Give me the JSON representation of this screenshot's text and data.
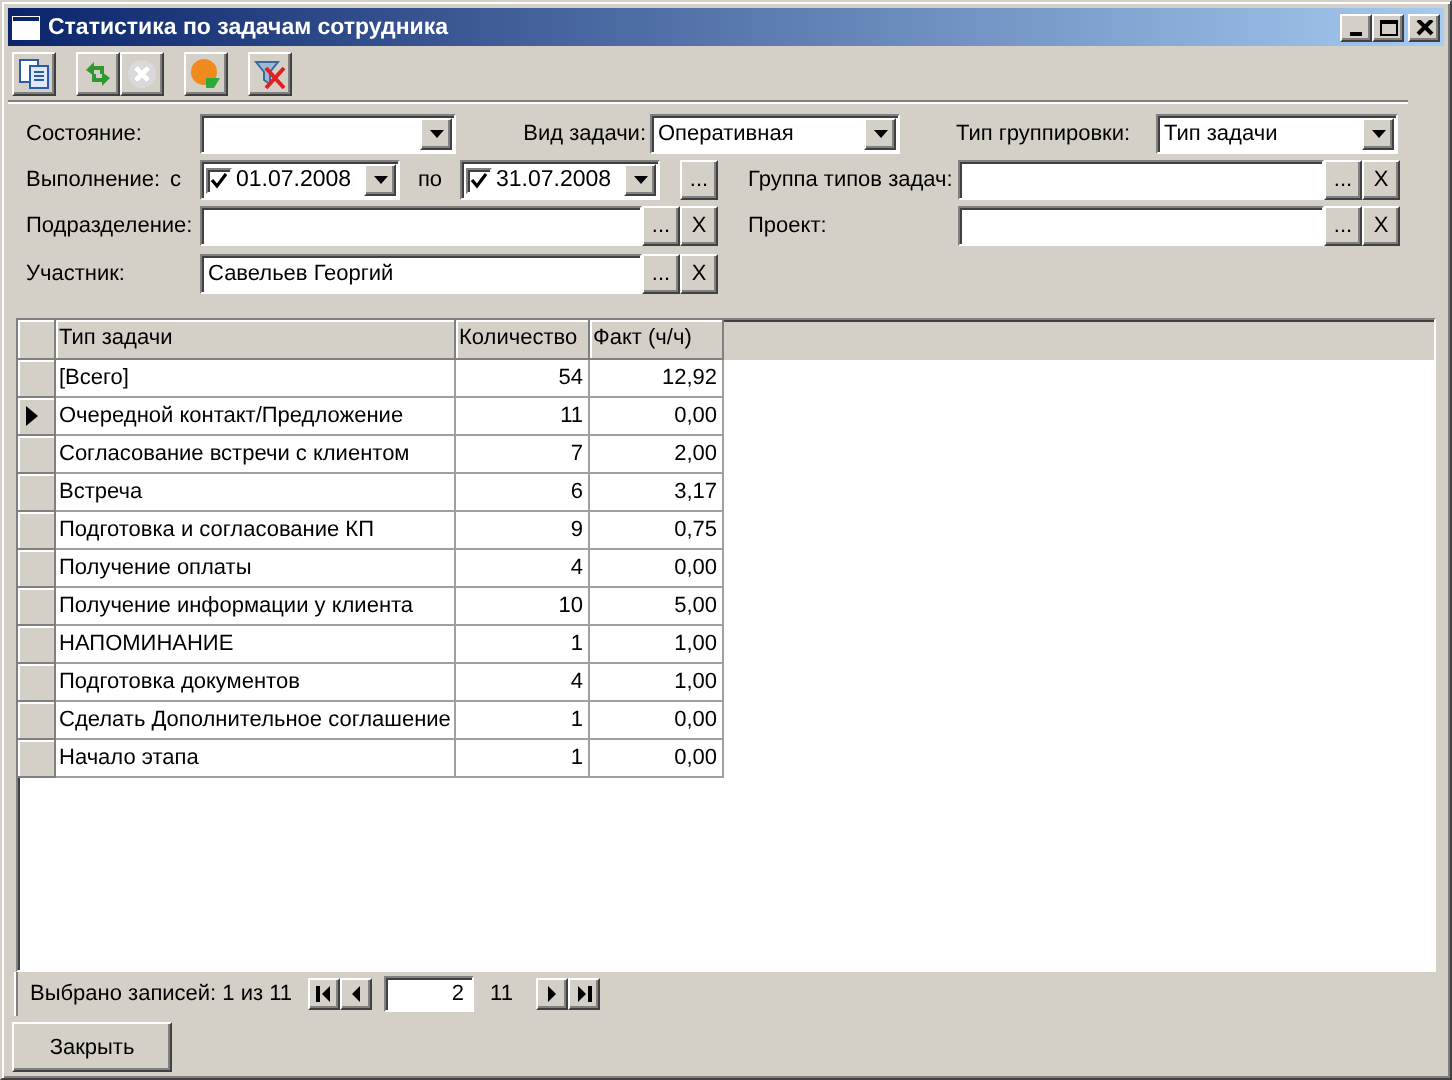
{
  "window": {
    "title": "Статистика по задачам сотрудника"
  },
  "toolbar": [
    [
      {
        "kind": "copy",
        "disabled": false
      }
    ],
    [
      {
        "kind": "refresh",
        "disabled": false
      },
      {
        "kind": "cancel",
        "disabled": true
      }
    ],
    [
      {
        "kind": "chart",
        "disabled": false
      }
    ],
    [
      {
        "kind": "clear-filter",
        "disabled": false
      }
    ]
  ],
  "filters": {
    "state": {
      "label": "Состояние:"
    },
    "task_type": {
      "label": "Вид задачи:",
      "value": "Оперативная"
    },
    "grouping": {
      "label": "Тип группировки:",
      "value": "Тип задачи"
    },
    "execution": {
      "label": "Выполнение:",
      "from_label": "с",
      "from": {
        "value": "01.07.2008",
        "checked": true
      },
      "to_label": "по",
      "to": {
        "value": "31.07.2008",
        "checked": true
      },
      "more": "..."
    },
    "task_type_group": {
      "label": "Группа типов задач:",
      "more": "...",
      "clear": "X"
    },
    "department": {
      "label": "Подразделение:",
      "more": "...",
      "clear": "X"
    },
    "project": {
      "label": "Проект:",
      "more": "...",
      "clear": "X"
    },
    "participant": {
      "label": "Участник:",
      "value": "Савельев Георгий",
      "more": "...",
      "clear": "X"
    }
  },
  "table": {
    "columns": [
      "Тип задачи",
      "Количество",
      "Факт (ч/ч)"
    ],
    "rows": [
      {
        "cells": [
          "[Всего]",
          "54",
          "12,92"
        ],
        "selected": false
      },
      {
        "cells": [
          "Очередной контакт/Предложение",
          "11",
          "0,00"
        ],
        "selected": true
      },
      {
        "cells": [
          "Согласование встречи с клиентом",
          "7",
          "2,00"
        ],
        "selected": false
      },
      {
        "cells": [
          "Встреча",
          "6",
          "3,17"
        ],
        "selected": false
      },
      {
        "cells": [
          "Подготовка и согласование КП",
          "9",
          "0,75"
        ],
        "selected": false
      },
      {
        "cells": [
          "Получение оплаты",
          "4",
          "0,00"
        ],
        "selected": false
      },
      {
        "cells": [
          "Получение информации у клиента",
          "10",
          "5,00"
        ],
        "selected": false
      },
      {
        "cells": [
          "НАПОМИНАНИЕ",
          "1",
          "1,00"
        ],
        "selected": false
      },
      {
        "cells": [
          "Подготовка документов",
          "4",
          "1,00"
        ],
        "selected": false
      },
      {
        "cells": [
          "Сделать Дополнительное соглашение",
          "1",
          "0,00"
        ],
        "selected": false
      },
      {
        "cells": [
          "Начало этапа",
          "1",
          "0,00"
        ],
        "selected": false
      }
    ]
  },
  "footer": {
    "status": "Выбрано записей: 1 из 11",
    "page": "2",
    "total": "11"
  },
  "buttons": [
    "Закрыть"
  ]
}
